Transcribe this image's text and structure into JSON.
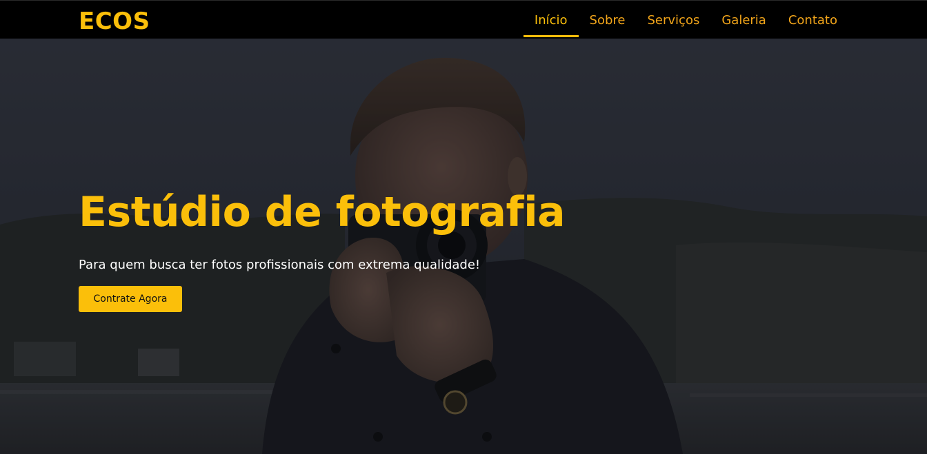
{
  "header": {
    "logo": "ECOS",
    "nav": [
      {
        "label": "Início",
        "active": true
      },
      {
        "label": "Sobre",
        "active": false
      },
      {
        "label": "Serviços",
        "active": false
      },
      {
        "label": "Galeria",
        "active": false
      },
      {
        "label": "Contato",
        "active": false
      }
    ]
  },
  "hero": {
    "title": "Estúdio de fotografia",
    "subtitle": "Para quem busca ter fotos profissionais com extrema qualidade!",
    "cta_label": "Contrate Agora",
    "background": "photographer-holding-camera-photo"
  },
  "colors": {
    "accent": "#fbbf0a",
    "nav_text": "#f2a51a",
    "header_bg": "#000000",
    "hero_text": "#ffffff"
  }
}
